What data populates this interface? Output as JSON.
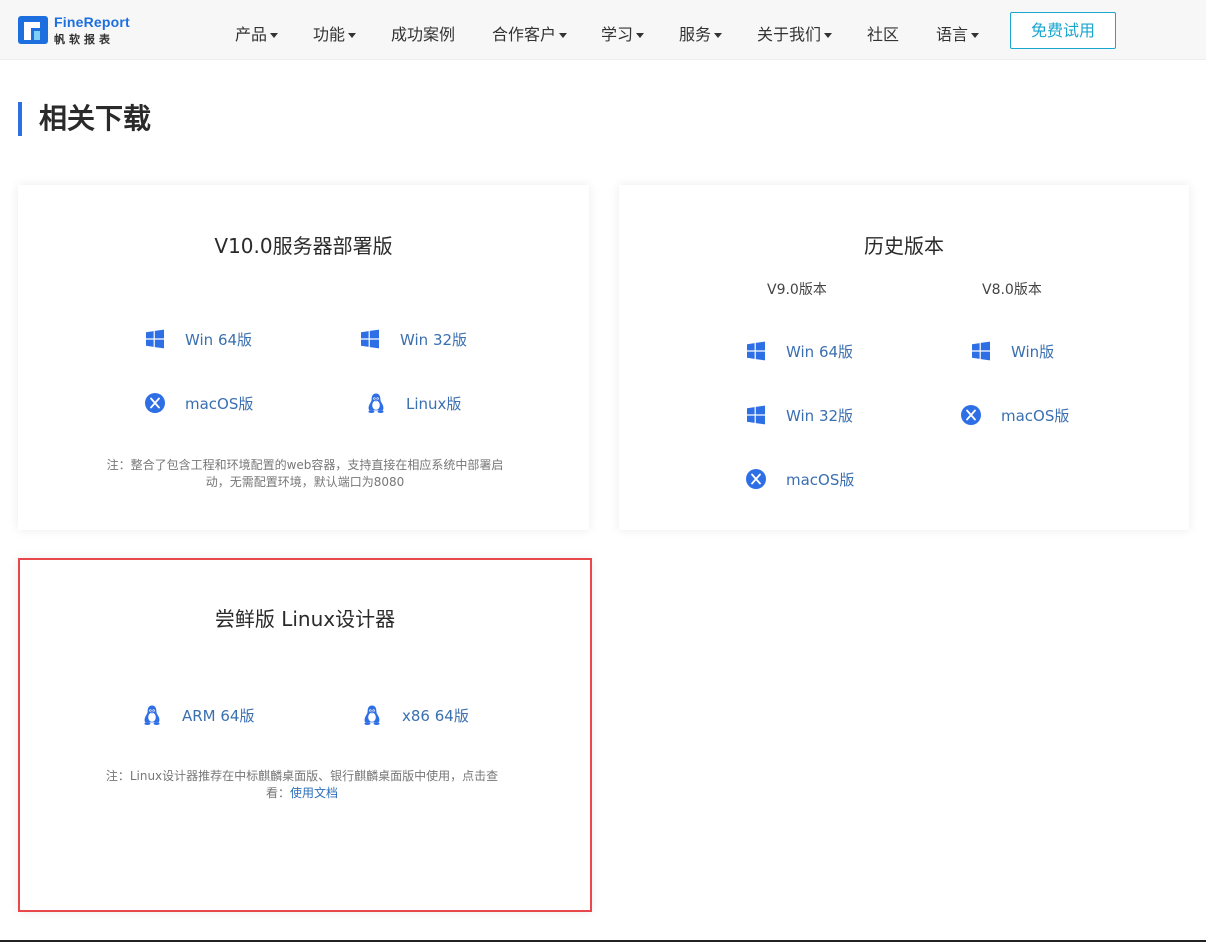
{
  "header": {
    "logo": {
      "en": "FineReport",
      "cn": "帆软报表"
    },
    "nav": [
      {
        "label": "产品",
        "dropdown": true
      },
      {
        "label": "功能",
        "dropdown": true
      },
      {
        "label": "成功案例",
        "dropdown": false
      },
      {
        "label": "合作客户",
        "dropdown": true
      },
      {
        "label": "学习",
        "dropdown": true
      },
      {
        "label": "服务",
        "dropdown": true
      },
      {
        "label": "关于我们",
        "dropdown": true
      },
      {
        "label": "社区",
        "dropdown": false
      },
      {
        "label": "语言",
        "dropdown": true
      }
    ],
    "trial_button": "免费试用"
  },
  "section_title": "相关下载",
  "server_card": {
    "title": "V10.0服务器部署版",
    "links": [
      {
        "label": "Win 64版",
        "icon": "windows-icon"
      },
      {
        "label": "Win 32版",
        "icon": "windows-icon"
      },
      {
        "label": "macOS版",
        "icon": "macos-icon"
      },
      {
        "label": "Linux版",
        "icon": "linux-icon"
      }
    ],
    "note": "注：整合了包含工程和环境配置的web容器，支持直接在相应系统中部署启动，无需配置环境，默认端口为8080"
  },
  "history_card": {
    "title": "历史版本",
    "columns": [
      {
        "heading": "V9.0版本",
        "links": [
          {
            "label": "Win 64版",
            "icon": "windows-icon"
          },
          {
            "label": "Win 32版",
            "icon": "windows-icon"
          },
          {
            "label": "macOS版",
            "icon": "macos-icon"
          }
        ]
      },
      {
        "heading": "V8.0版本",
        "links": [
          {
            "label": "Win版",
            "icon": "windows-icon"
          },
          {
            "label": "macOS版",
            "icon": "macos-icon"
          }
        ]
      }
    ]
  },
  "linux_card": {
    "title": "尝鲜版 Linux设计器",
    "links": [
      {
        "label": "ARM 64版",
        "icon": "linux-icon"
      },
      {
        "label": "x86 64版",
        "icon": "linux-icon"
      }
    ],
    "note_prefix": "注：Linux设计器推荐在中标麒麟桌面版、银行麒麟桌面版中使用，点击查看：",
    "note_link": "使用文档"
  },
  "colors": {
    "accent_blue": "#2f6fe6",
    "link_blue": "#3a6fb0",
    "trial_cyan": "#1aa6cf",
    "highlight_red": "#e8474b"
  }
}
